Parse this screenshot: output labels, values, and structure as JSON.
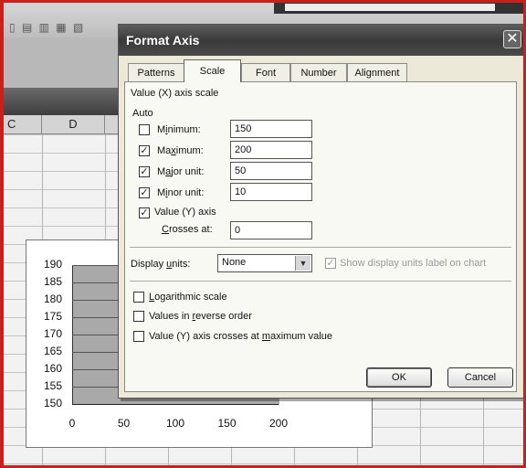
{
  "dialog": {
    "title": "Format Axis",
    "close_symbol": "✕",
    "tabs": [
      {
        "label": "Patterns",
        "active": false
      },
      {
        "label": "Scale",
        "active": true
      },
      {
        "label": "Font",
        "active": false
      },
      {
        "label": "Number",
        "active": false
      },
      {
        "label": "Alignment",
        "active": false
      }
    ],
    "scale": {
      "heading": "Value (X) axis scale",
      "auto_label": "Auto",
      "minimum": {
        "label": "Minimum:",
        "checked": false,
        "value": "150"
      },
      "maximum": {
        "label": "Maximum:",
        "checked": true,
        "value": "200"
      },
      "major_unit": {
        "label": "Major unit:",
        "checked": true,
        "value": "50"
      },
      "minor_unit": {
        "label": "Minor unit:",
        "checked": true,
        "value": "10"
      },
      "value_axis": {
        "label": "Value (Y) axis",
        "checked": true
      },
      "crosses_at": {
        "label": "Crosses at:",
        "value": "0"
      },
      "display_units": {
        "label": "Display units:",
        "value": "None"
      },
      "show_display_units": {
        "label": "Show display units label on chart",
        "checked": true,
        "enabled": false
      },
      "logarithmic": {
        "label": "Logarithmic scale",
        "checked": false
      },
      "reverse_order": {
        "label": "Values in reverse order",
        "checked": false
      },
      "crosses_at_max": {
        "label": "Value (Y) axis crosses at maximum value",
        "checked": false
      }
    },
    "ok_label": "OK",
    "cancel_label": "Cancel"
  },
  "sheet": {
    "column_headers": [
      "C",
      "D"
    ]
  },
  "chart_data": {
    "type": "scatter",
    "y_ticks": [
      "190",
      "185",
      "180",
      "175",
      "170",
      "165",
      "160",
      "155",
      "150"
    ],
    "x_ticks": [
      "0",
      "50",
      "100",
      "150",
      "200"
    ],
    "ylim": [
      150,
      190
    ],
    "xlim": [
      0,
      200
    ],
    "grid": true
  },
  "colors": {
    "frame": "#c8201c",
    "plot_area": "#a9a9a9"
  }
}
